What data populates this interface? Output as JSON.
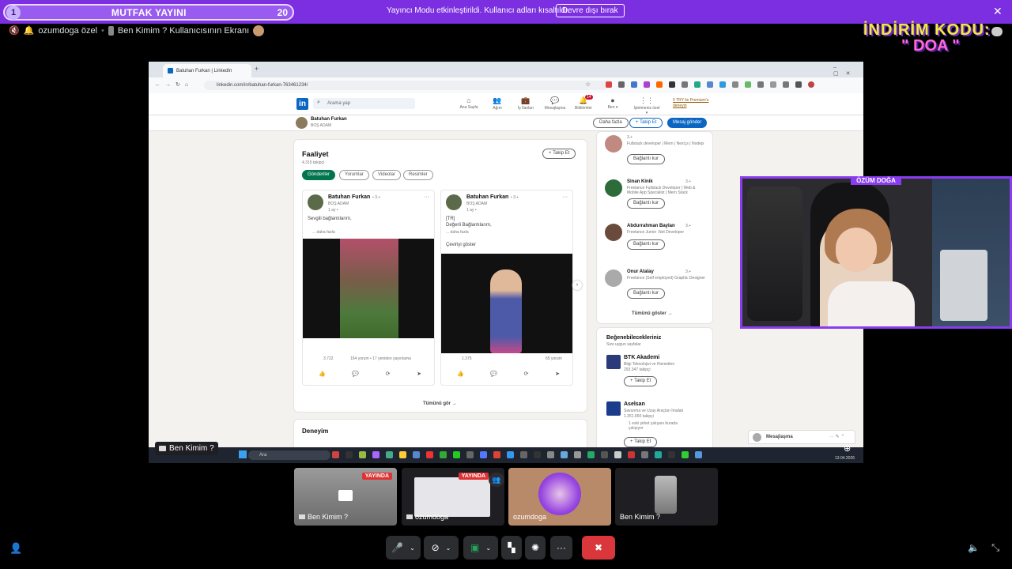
{
  "stream_bar": {
    "left_number": "1",
    "title": "MUTFAK YAYINI",
    "right_number": "20",
    "message": "Yayıncı Modu etkinleştirildi. Kullanıcı adları kısaltıldı.",
    "disable_button": "Devre dışı bırak"
  },
  "channel_bar": {
    "voice_channel": "ozumdoga özel",
    "screen_share": "Ben Kimim ? Kullanıcısının Ekranı"
  },
  "promo": {
    "line1": "İNDİRİM KODU:",
    "line2": "\" DOA \""
  },
  "browser": {
    "tab_title": "Batuhan Furkan | LinkedIn",
    "url": "linkedin.com/in/batuhan-furkan-763461234/",
    "search_placeholder": "Arama yap",
    "nav": [
      {
        "icon": "home-icon",
        "label": "Ana Sayfa"
      },
      {
        "icon": "network-icon",
        "label": "Ağım"
      },
      {
        "icon": "briefcase-icon",
        "label": "İş İlanları"
      },
      {
        "icon": "message-icon",
        "label": "Mesajlaşma"
      },
      {
        "icon": "bell-icon",
        "label": "Bildirimler",
        "badge": "14"
      },
      {
        "icon": "avatar-icon",
        "label": "Ben ▾"
      },
      {
        "icon": "grid-icon",
        "label": "İşletmeniz özel ▾"
      }
    ],
    "premium_link": "0 TRY ile Premium'u deneyin",
    "profile": {
      "name": "Batuhan Furkan",
      "subtitle": "BOŞ ADAM",
      "more": "Daha fazla",
      "follow": "+ Takip Et",
      "message": "Mesaj gönder"
    },
    "activity": {
      "title": "Faaliyet",
      "followers": "4.315 takipçi",
      "follow_button": "+ Takip Et",
      "filters": [
        "Gönderiler",
        "Yorumlar",
        "Videolar",
        "Resimler"
      ],
      "posts": [
        {
          "author": "Batuhan Furkan",
          "degree": "• 3.+",
          "subtitle": "BOŞ ADAM",
          "time": "1 ay •",
          "text": "Sevgili bağlantılarım,",
          "more": "... daha fazla",
          "reactions": "3.722",
          "stats": "164 yorum • 17 yeniden yayınlama"
        },
        {
          "author": "Batuhan Furkan",
          "degree": "• 3.+",
          "subtitle": "BOŞ ADAM",
          "time": "1 ay •",
          "text": "[TR]",
          "text2": "Değerli Bağlantılarım,",
          "more": "... daha fazla",
          "translate": "Çeviriyi göster",
          "reactions": "1.375",
          "stats": "65 yorum"
        }
      ],
      "see_all": "Tümünü gör →"
    },
    "experience_title": "Deneyim",
    "people": [
      {
        "name": "",
        "degree": "3.+",
        "headline": "Fullstack developer | Mern | Next.js | Nodejs",
        "button": "Bağlantı kur"
      },
      {
        "name": "Sinan Kinik",
        "degree": "3.+",
        "headline": "Freelance Fullstack Developer | Web & Mobile App Specialist | Mern Stack",
        "button": "Bağlantı kur"
      },
      {
        "name": "Abdurrahman Baylan",
        "degree": "3.+",
        "headline": "Freelance Junior .Net Developer",
        "button": "Bağlantı kur"
      },
      {
        "name": "Onur Atalay",
        "degree": "3.+",
        "headline": "Freelance (Self employed) Graphic Designer",
        "button": "Bağlantı kur"
      }
    ],
    "people_see_all": "Tümünü göster →",
    "pages": {
      "title": "Beğenebilecekleriniz",
      "subtitle": "Size uygun sayfalar",
      "items": [
        {
          "name": "BTK Akademi",
          "desc": "Bilgi Teknolojisi ve Hizmetleri",
          "followers": "293.347 takipçi",
          "button": "+ Takip Et"
        },
        {
          "name": "Aselsan",
          "desc": "Savunma ve Uzay Araçları İmalatı",
          "followers": "1.351.650 takipçi",
          "note": "1 eski şirket çalışanı burada çalışıyor",
          "button": "+ Takip Et"
        }
      ]
    },
    "messaging": "Mesajlaşma",
    "taskbar_search": "Ara",
    "taskbar_date": "13.04.2026"
  },
  "webcam_label": "ÖZÜM DOĞA",
  "screen_caption": "Ben Kimim ?",
  "participants": [
    {
      "name": "Ben Kimim ?",
      "live": "YAYINDA"
    },
    {
      "name": "ozumdoga",
      "live": "YAYINDA"
    },
    {
      "name": "ozumdoga",
      "live": ""
    },
    {
      "name": "Ben Kimim ?",
      "live": ""
    }
  ]
}
